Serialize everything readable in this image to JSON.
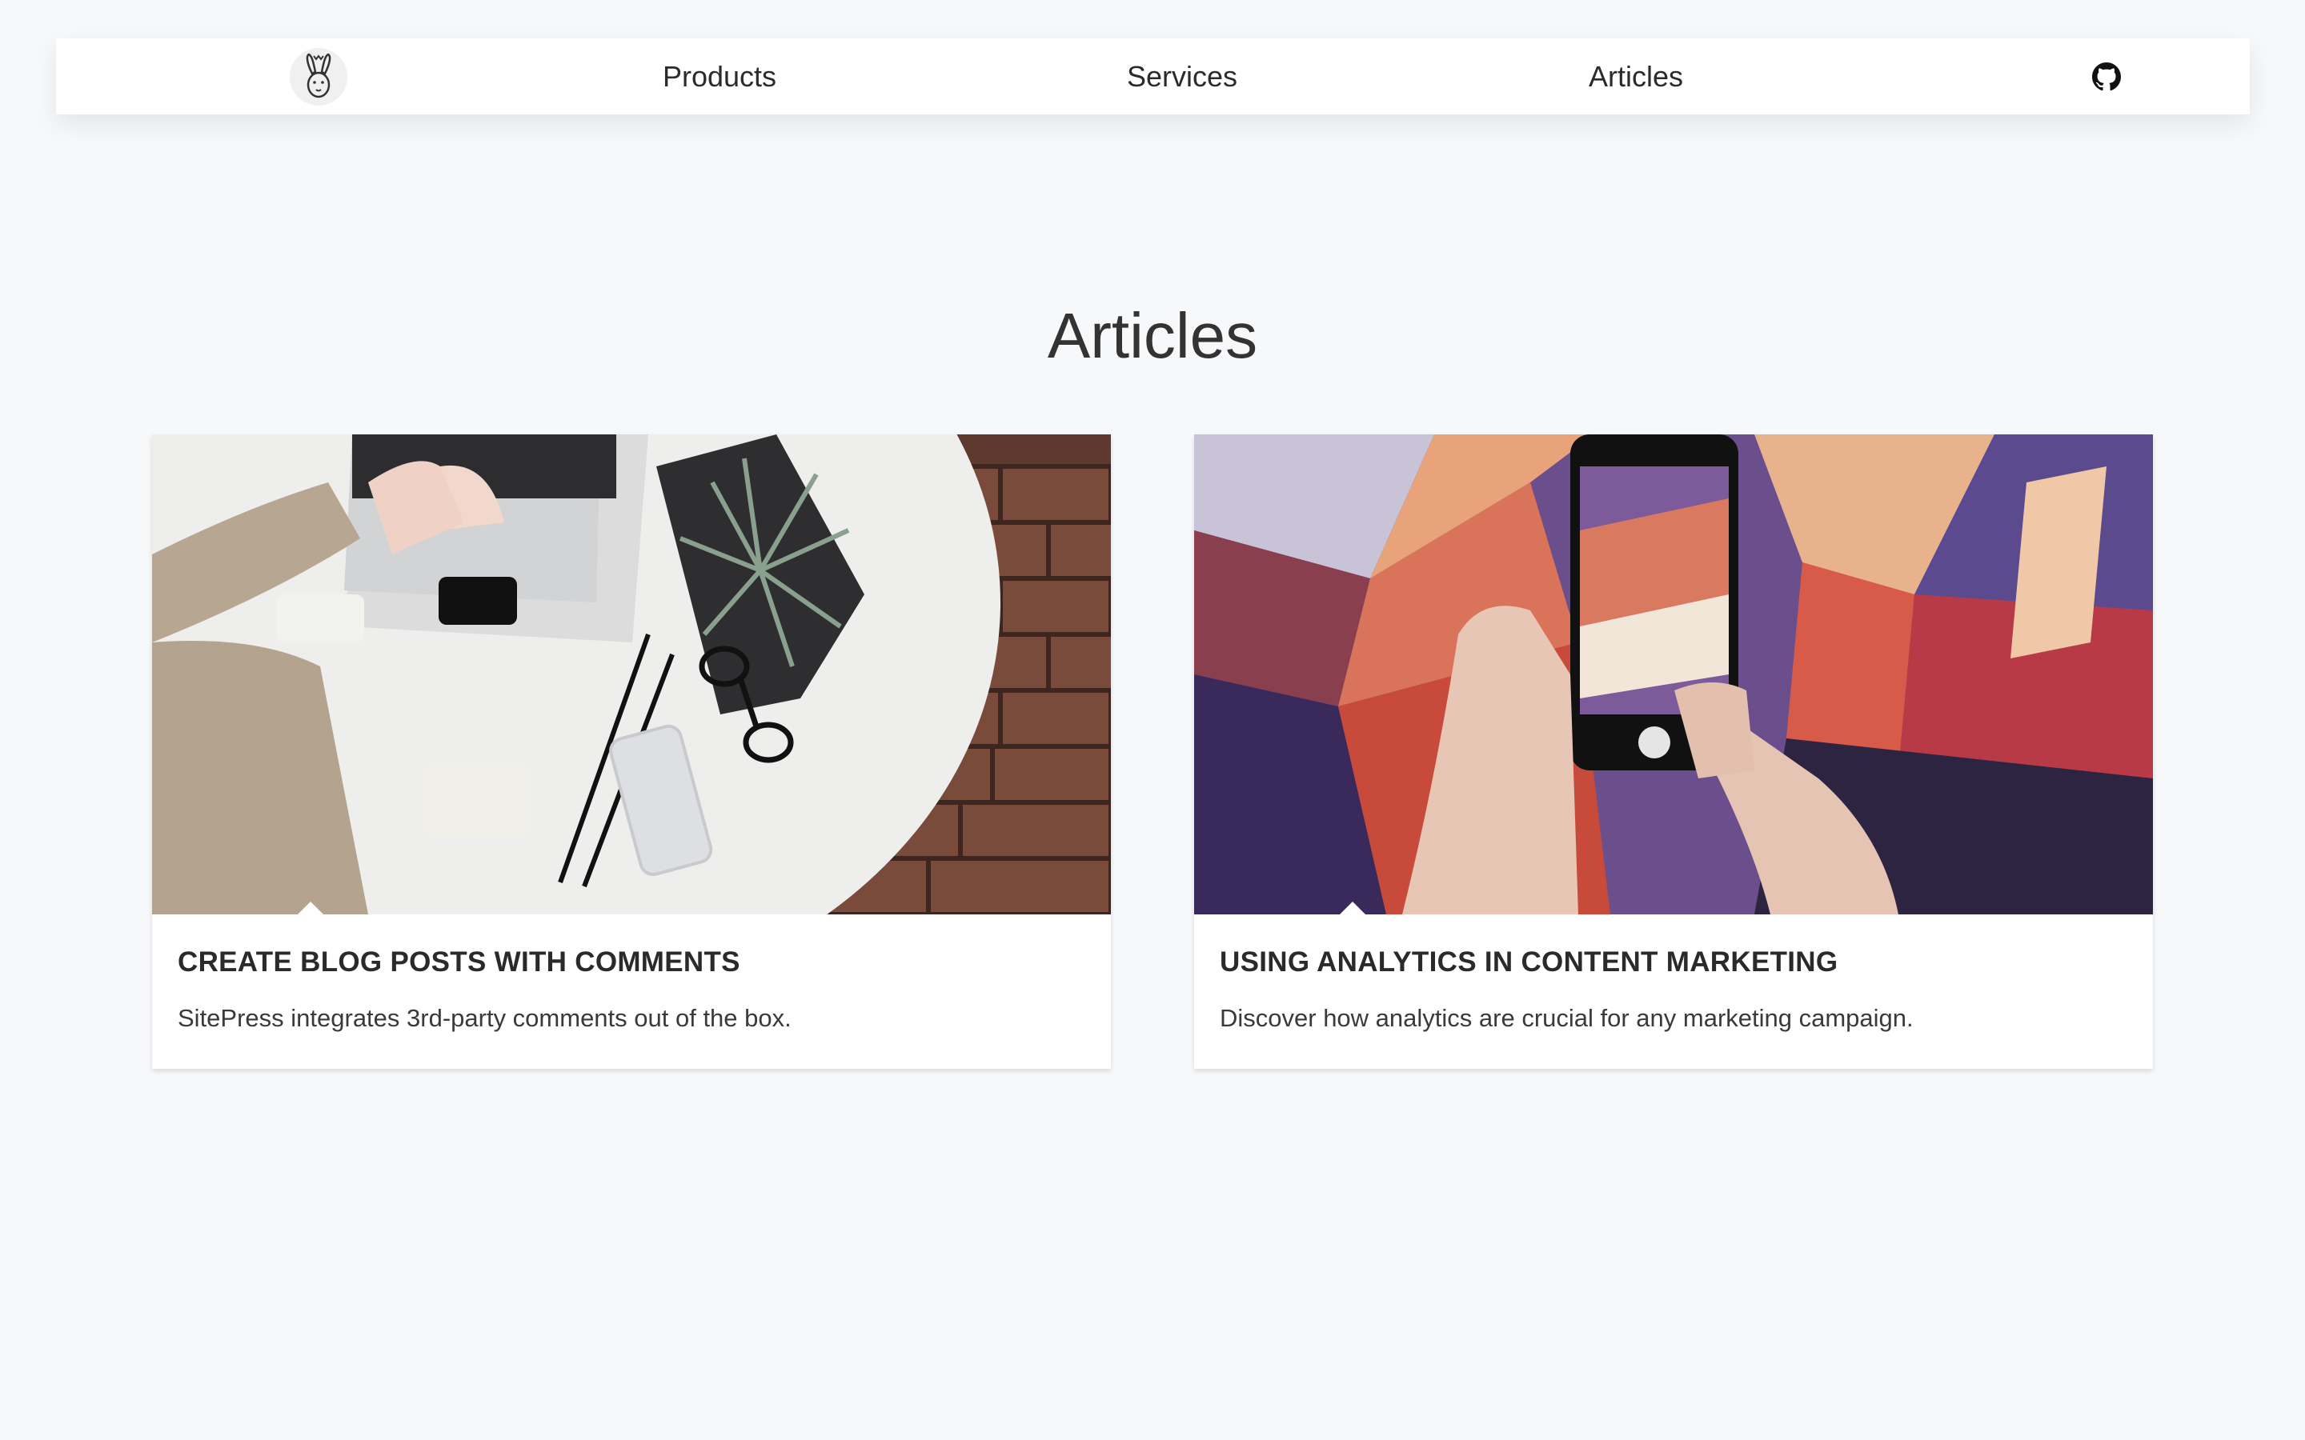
{
  "nav": {
    "logo_icon": "rabbit-logo-icon",
    "links": [
      {
        "label": "Products"
      },
      {
        "label": "Services"
      },
      {
        "label": "Articles"
      }
    ],
    "github_icon": "github-icon"
  },
  "page": {
    "title": "Articles"
  },
  "articles": [
    {
      "title": "CREATE BLOG POSTS WITH COMMENTS",
      "description": "SitePress integrates 3rd-party comments out of the box.",
      "image": "laptop-desk-photo"
    },
    {
      "title": "USING ANALYTICS IN CONTENT MARKETING",
      "description": "Discover how analytics are crucial for any marketing campaign.",
      "image": "phone-graffiti-photo"
    }
  ],
  "colors": {
    "background": "#f7f8fa",
    "card": "#ffffff",
    "text": "#2a2a2a"
  }
}
